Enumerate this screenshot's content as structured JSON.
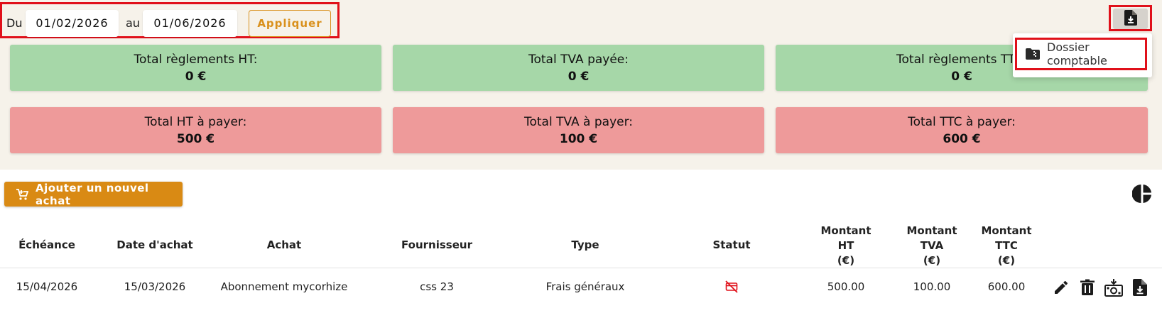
{
  "filters": {
    "from_label": "Du",
    "from_value": "01/02/2026",
    "to_label": "au",
    "to_value": "01/06/2026",
    "apply_label": "Appliquer"
  },
  "export_menu": {
    "button_icon": "file-download-icon",
    "items": [
      {
        "label": "Dossier comptable",
        "icon": "folder-zip-icon"
      }
    ]
  },
  "summary": {
    "paid": [
      {
        "title": "Total règlements HT:",
        "value": "0 €"
      },
      {
        "title": "Total TVA payée:",
        "value": "0 €"
      },
      {
        "title": "Total règlements TTC:",
        "value": "0 €"
      }
    ],
    "due": [
      {
        "title": "Total HT à payer:",
        "value": "500 €"
      },
      {
        "title": "Total TVA à payer:",
        "value": "100 €"
      },
      {
        "title": "Total TTC à payer:",
        "value": "600 €"
      }
    ]
  },
  "actions": {
    "add_label": "Ajouter un nouvel achat",
    "add_icon": "cart-plus-icon",
    "stats_icon": "pie-chart-icon"
  },
  "table": {
    "columns": {
      "echeance": "Échéance",
      "date_achat": "Date d'achat",
      "achat": "Achat",
      "fournisseur": "Fournisseur",
      "type": "Type",
      "statut": "Statut",
      "ht": [
        "Montant",
        "HT",
        "(€)"
      ],
      "tva": [
        "Montant",
        "TVA",
        "(€)"
      ],
      "ttc": [
        "Montant",
        "TTC",
        "(€)"
      ]
    },
    "rows": [
      {
        "echeance": "15/04/2026",
        "date_achat": "15/03/2026",
        "achat": "Abonnement mycorhize",
        "fournisseur": "css 23",
        "type": "Frais généraux",
        "statut_icon": "unpaid-icon",
        "ht": "500.00",
        "tva": "100.00",
        "ttc": "600.00"
      }
    ]
  },
  "colors": {
    "accent": "#d98a14",
    "paid_card": "#a6d7a8",
    "due_card": "#ee9a9a",
    "status_unpaid": "#e0101a",
    "highlight_border": "#e0101a"
  }
}
